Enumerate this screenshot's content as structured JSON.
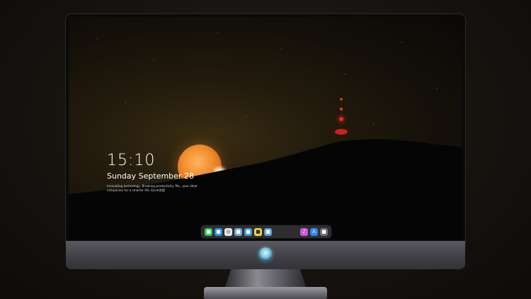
{
  "lock_screen": {
    "time": "15:10",
    "date": "Sunday September 28",
    "tagline": "Innovating technology, Breaking productivity. Mo., your ideal companion for a smarter life. Excel合图"
  },
  "dock": {
    "items": [
      {
        "name": "messages-icon",
        "color": "#34c759",
        "glyph": "■"
      },
      {
        "name": "finder-icon",
        "color": "#2d8cf0",
        "glyph": "■"
      },
      {
        "name": "safari-icon",
        "color": "#e8e8e8",
        "glyph": "◎"
      },
      {
        "name": "preview-icon",
        "color": "#7aa7c7",
        "glyph": "■"
      },
      {
        "name": "claquette-icon",
        "color": "#3a9fd6",
        "glyph": "■"
      },
      {
        "name": "notes-icon",
        "color": "#f7d54a",
        "glyph": "■"
      },
      {
        "name": "photos-app-icon",
        "color": "#5aa3c9",
        "glyph": "■"
      },
      {
        "name": "music-icon",
        "color": "#c85ad8",
        "glyph": "♪"
      },
      {
        "name": "app-store-icon",
        "color": "#2f86e8",
        "glyph": "A"
      },
      {
        "name": "camera-icon",
        "color": "#707078",
        "glyph": "■"
      }
    ]
  },
  "colors": {
    "moon": "#f08a2a",
    "tower_light": "#ff2a1a",
    "accent_logo": "#7ec8e3"
  }
}
